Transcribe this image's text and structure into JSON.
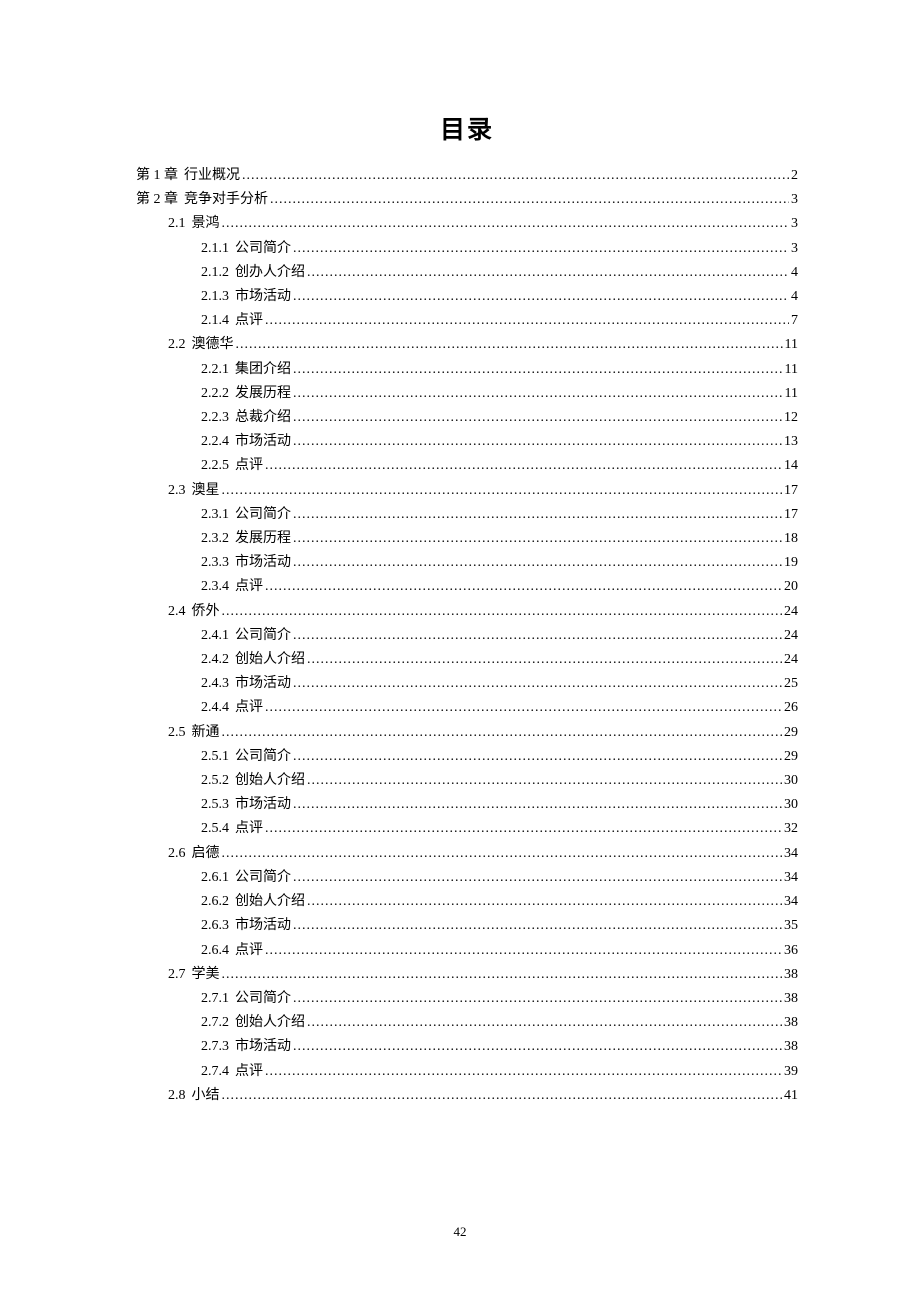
{
  "title": "目录",
  "page_number": "42",
  "entries": [
    {
      "level": 1,
      "number": "第 1 章",
      "label": "行业概况",
      "page": "2"
    },
    {
      "level": 1,
      "number": "第 2 章",
      "label": "竞争对手分析",
      "page": "3"
    },
    {
      "level": 2,
      "number": "2.1",
      "label": "景鸿",
      "page": "3"
    },
    {
      "level": 3,
      "number": "2.1.1",
      "label": "公司简介",
      "page": "3"
    },
    {
      "level": 3,
      "number": "2.1.2",
      "label": "创办人介绍",
      "page": "4"
    },
    {
      "level": 3,
      "number": "2.1.3",
      "label": "市场活动",
      "page": "4"
    },
    {
      "level": 3,
      "number": "2.1.4",
      "label": "点评",
      "page": "7"
    },
    {
      "level": 2,
      "number": "2.2",
      "label": "澳德华",
      "page": "11"
    },
    {
      "level": 3,
      "number": "2.2.1",
      "label": "集团介绍",
      "page": "11"
    },
    {
      "level": 3,
      "number": "2.2.2",
      "label": "发展历程",
      "page": "11"
    },
    {
      "level": 3,
      "number": "2.2.3",
      "label": "总裁介绍",
      "page": "12"
    },
    {
      "level": 3,
      "number": "2.2.4",
      "label": "市场活动",
      "page": "13"
    },
    {
      "level": 3,
      "number": "2.2.5",
      "label": "点评",
      "page": "14"
    },
    {
      "level": 2,
      "number": "2.3",
      "label": "澳星",
      "page": "17"
    },
    {
      "level": 3,
      "number": "2.3.1",
      "label": "公司简介",
      "page": "17"
    },
    {
      "level": 3,
      "number": "2.3.2",
      "label": "发展历程",
      "page": "18"
    },
    {
      "level": 3,
      "number": "2.3.3",
      "label": "市场活动",
      "page": "19"
    },
    {
      "level": 3,
      "number": "2.3.4",
      "label": "点评",
      "page": "20"
    },
    {
      "level": 2,
      "number": "2.4",
      "label": "侨外",
      "page": "24"
    },
    {
      "level": 3,
      "number": "2.4.1",
      "label": "公司简介",
      "page": "24"
    },
    {
      "level": 3,
      "number": "2.4.2",
      "label": "创始人介绍",
      "page": "24"
    },
    {
      "level": 3,
      "number": "2.4.3",
      "label": "市场活动",
      "page": "25"
    },
    {
      "level": 3,
      "number": "2.4.4",
      "label": "点评",
      "page": "26"
    },
    {
      "level": 2,
      "number": "2.5",
      "label": "新通",
      "page": "29"
    },
    {
      "level": 3,
      "number": "2.5.1",
      "label": "公司简介",
      "page": "29"
    },
    {
      "level": 3,
      "number": "2.5.2",
      "label": "创始人介绍",
      "page": "30"
    },
    {
      "level": 3,
      "number": "2.5.3",
      "label": "市场活动",
      "page": "30"
    },
    {
      "level": 3,
      "number": "2.5.4",
      "label": "点评",
      "page": "32"
    },
    {
      "level": 2,
      "number": "2.6",
      "label": "启德",
      "page": "34"
    },
    {
      "level": 3,
      "number": "2.6.1",
      "label": "公司简介",
      "page": "34"
    },
    {
      "level": 3,
      "number": "2.6.2",
      "label": "创始人介绍",
      "page": "34"
    },
    {
      "level": 3,
      "number": "2.6.3",
      "label": "市场活动",
      "page": "35"
    },
    {
      "level": 3,
      "number": "2.6.4",
      "label": "点评",
      "page": "36"
    },
    {
      "level": 2,
      "number": "2.7",
      "label": "学美",
      "page": "38"
    },
    {
      "level": 3,
      "number": "2.7.1",
      "label": "公司简介",
      "page": "38"
    },
    {
      "level": 3,
      "number": "2.7.2",
      "label": "创始人介绍",
      "page": "38"
    },
    {
      "level": 3,
      "number": "2.7.3",
      "label": "市场活动",
      "page": "38"
    },
    {
      "level": 3,
      "number": "2.7.4",
      "label": "点评",
      "page": "39"
    },
    {
      "level": 2,
      "number": "2.8",
      "label": "小结",
      "page": "41"
    }
  ]
}
